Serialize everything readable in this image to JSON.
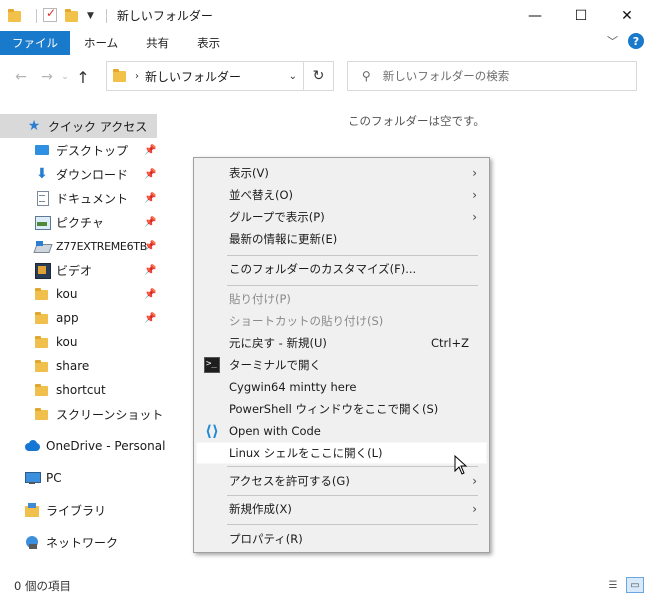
{
  "window": {
    "title": "新しいフォルダー",
    "controls": {
      "minimize": "—",
      "maximize": "☐",
      "close": "✕"
    }
  },
  "ribbon": {
    "tabs": [
      "ファイル",
      "ホーム",
      "共有",
      "表示"
    ],
    "help": "?"
  },
  "address": {
    "path": "新しいフォルダー",
    "search_placeholder": "新しいフォルダーの検索"
  },
  "sidebar": {
    "quick_access": "クイック アクセス",
    "items": [
      {
        "label": "デスクトップ",
        "icon": "desktop-icon",
        "pinned": true
      },
      {
        "label": "ダウンロード",
        "icon": "download-icon",
        "pinned": true
      },
      {
        "label": "ドキュメント",
        "icon": "documents-icon",
        "pinned": true
      },
      {
        "label": "ピクチャ",
        "icon": "pictures-icon",
        "pinned": true
      },
      {
        "label": "Z77EXTREME6TB",
        "icon": "drive-icon",
        "pinned": true
      },
      {
        "label": "ビデオ",
        "icon": "videos-icon",
        "pinned": true
      },
      {
        "label": "kou",
        "icon": "folder-icon",
        "pinned": true
      },
      {
        "label": "app",
        "icon": "folder-icon",
        "pinned": true
      },
      {
        "label": "kou",
        "icon": "folder-icon",
        "pinned": false
      },
      {
        "label": "share",
        "icon": "folder-icon",
        "pinned": false
      },
      {
        "label": "shortcut",
        "icon": "folder-icon",
        "pinned": false
      },
      {
        "label": "スクリーンショット",
        "icon": "folder-icon",
        "pinned": false
      }
    ],
    "onedrive": "OneDrive - Personal",
    "pc": "PC",
    "library": "ライブラリ",
    "network": "ネットワーク"
  },
  "main": {
    "empty_message": "このフォルダーは空です。"
  },
  "status": {
    "item_count": "0 個の項目"
  },
  "context_menu": {
    "items": [
      {
        "label": "表示(V)",
        "submenu": true
      },
      {
        "label": "並べ替え(O)",
        "submenu": true
      },
      {
        "label": "グループで表示(P)",
        "submenu": true
      },
      {
        "label": "最新の情報に更新(E)"
      },
      {
        "label": "このフォルダーのカスタマイズ(F)..."
      },
      {
        "label": "貼り付け(P)",
        "disabled": true
      },
      {
        "label": "ショートカットの貼り付け(S)",
        "disabled": true
      },
      {
        "label": "元に戻す - 新規(U)",
        "shortcut": "Ctrl+Z"
      },
      {
        "label": "ターミナルで開く",
        "icon": "terminal-icon"
      },
      {
        "label": "Cygwin64 mintty here"
      },
      {
        "label": "PowerShell ウィンドウをここで開く(S)"
      },
      {
        "label": "Open with Code",
        "icon": "vscode-icon"
      },
      {
        "label": "Linux シェルをここに開く(L)",
        "hover": true
      },
      {
        "label": "アクセスを許可する(G)",
        "submenu": true
      },
      {
        "label": "新規作成(X)",
        "submenu": true
      },
      {
        "label": "プロパティ(R)"
      }
    ]
  }
}
